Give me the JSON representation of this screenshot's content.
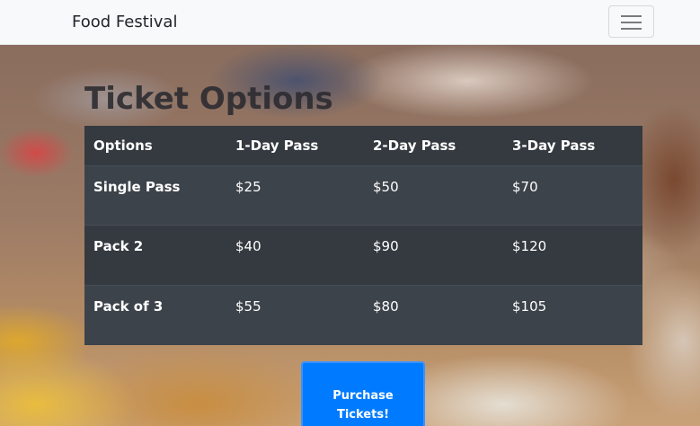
{
  "navbar": {
    "brand": "Food Festival",
    "menu_icon": "hamburger-menu-icon"
  },
  "hero": {
    "title": "Ticket Options"
  },
  "ticket_table": {
    "headers": [
      "Options",
      "1-Day Pass",
      "2-Day Pass",
      "3-Day Pass"
    ],
    "rows": [
      [
        "Single Pass",
        "$25",
        "$50",
        "$70"
      ],
      [
        "Pack 2",
        "$40",
        "$90",
        "$120"
      ],
      [
        "Pack of 3",
        "$55",
        "$80",
        "$105"
      ]
    ]
  },
  "purchase_button": {
    "label": "Purchase Tickets!"
  },
  "colors": {
    "navbar_bg": "#f8f9fa",
    "table_bg": "#343a40",
    "button_bg": "#007bff"
  }
}
